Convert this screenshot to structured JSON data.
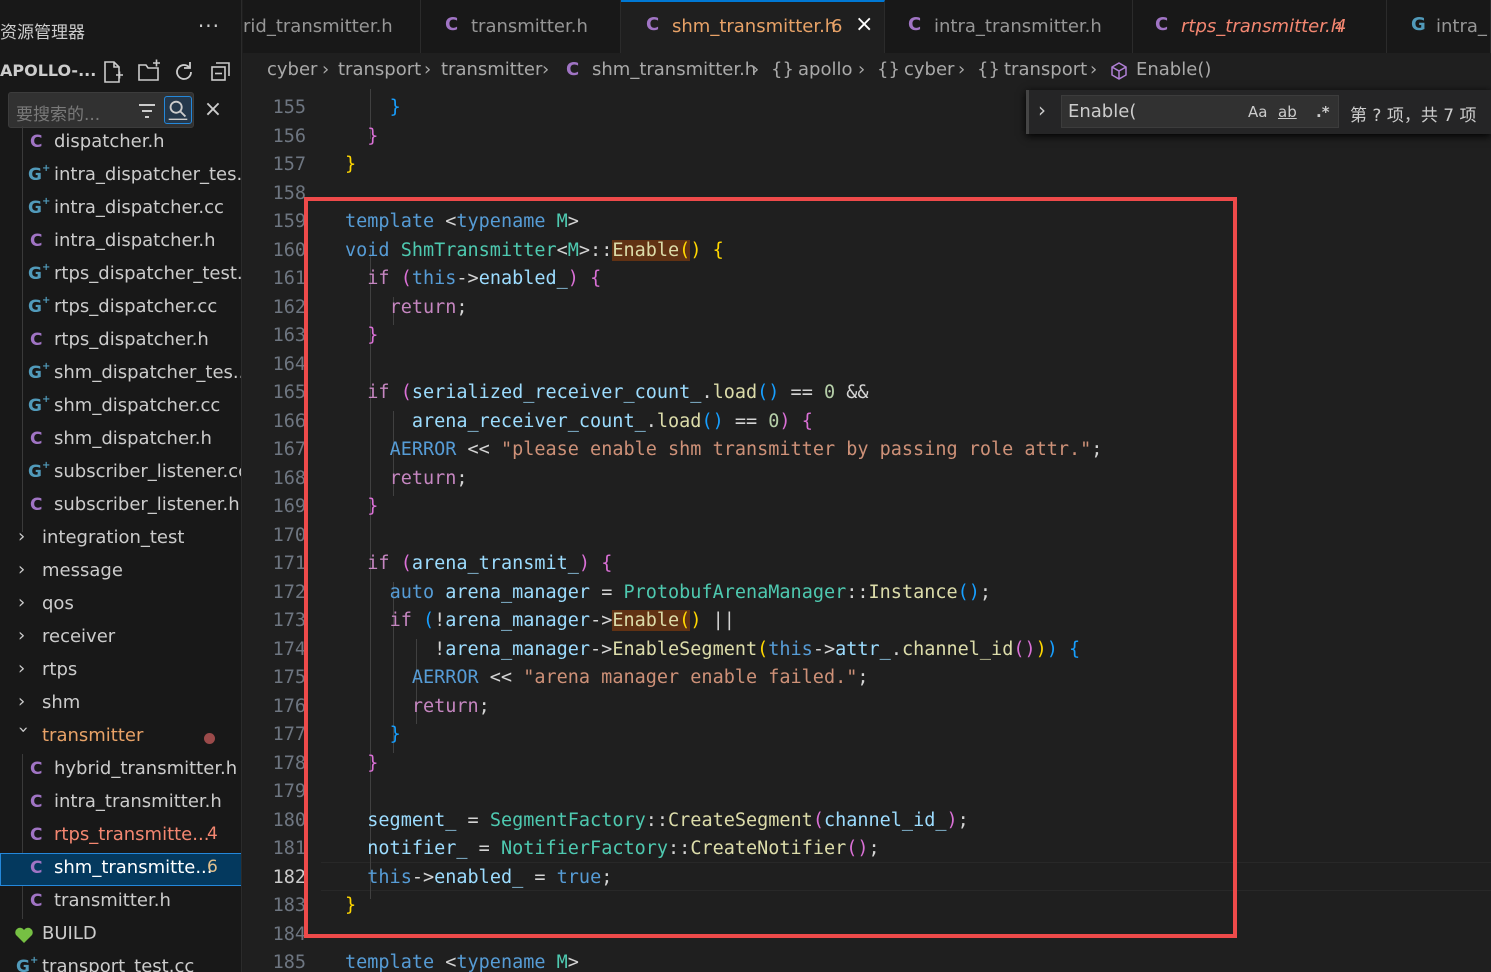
{
  "sidebar": {
    "title": "资源管理器",
    "more": "···",
    "project": "APOLLO-...",
    "search_placeholder": "要搜索的...",
    "items": [
      {
        "kind": "c",
        "label": "dispatcher.h"
      },
      {
        "kind": "cpp",
        "label": "intra_dispatcher_tes..."
      },
      {
        "kind": "cpp",
        "label": "intra_dispatcher.cc"
      },
      {
        "kind": "c",
        "label": "intra_dispatcher.h"
      },
      {
        "kind": "cpp",
        "label": "rtps_dispatcher_test..."
      },
      {
        "kind": "cpp",
        "label": "rtps_dispatcher.cc"
      },
      {
        "kind": "c",
        "label": "rtps_dispatcher.h"
      },
      {
        "kind": "cpp",
        "label": "shm_dispatcher_tes..."
      },
      {
        "kind": "cpp",
        "label": "shm_dispatcher.cc"
      },
      {
        "kind": "c",
        "label": "shm_dispatcher.h"
      },
      {
        "kind": "cpp",
        "label": "subscriber_listener.cc"
      },
      {
        "kind": "c",
        "label": "subscriber_listener.h"
      }
    ],
    "folders": [
      "integration_test",
      "message",
      "qos",
      "receiver",
      "rtps",
      "shm"
    ],
    "open_folder": "transmitter",
    "transmitter_files": [
      {
        "label": "hybrid_transmitter.h",
        "badge": ""
      },
      {
        "label": "intra_transmitter.h",
        "badge": ""
      },
      {
        "label": "rtps_transmitte...",
        "badge": "4"
      },
      {
        "label": "shm_transmitte...",
        "badge": "6"
      },
      {
        "label": "transmitter.h",
        "badge": ""
      }
    ],
    "build": "BUILD",
    "last_item": "transport_test.cc"
  },
  "tabs": [
    {
      "label": "rid_transmitter.h",
      "kind": "c"
    },
    {
      "label": "transmitter.h",
      "kind": "c"
    },
    {
      "label": "shm_transmitter.h",
      "badge": "6",
      "kind": "c"
    },
    {
      "label": "intra_transmitter.h",
      "kind": "c"
    },
    {
      "label": "rtps_transmitter.h",
      "badge": "4",
      "kind": "c"
    },
    {
      "label": "intra_",
      "kind": "cpp"
    }
  ],
  "tab_close": "×",
  "breadcrumb": [
    "cyber",
    "transport",
    "transmitter",
    "shm_transmitter.h",
    "apollo",
    "cyber",
    "transport",
    "Enable()"
  ],
  "find": {
    "value": "Enable(",
    "match_case": "Aa",
    "whole_word": "ab",
    "regex": ".*",
    "result": "第 ? 项，共 7 项"
  },
  "editor": {
    "current_line": "182",
    "line_numbers": [
      "155",
      "156",
      "157",
      "158",
      "159",
      "160",
      "161",
      "162",
      "163",
      "164",
      "165",
      "166",
      "167",
      "168",
      "169",
      "170",
      "171",
      "172",
      "173",
      "174",
      "175",
      "176",
      "177",
      "178",
      "179",
      "180",
      "181",
      "182",
      "183",
      "184",
      "185"
    ]
  },
  "colors": {
    "highlight_box": "#ee4a4a",
    "accent": "#0078d4",
    "modified": "#e8a267"
  }
}
